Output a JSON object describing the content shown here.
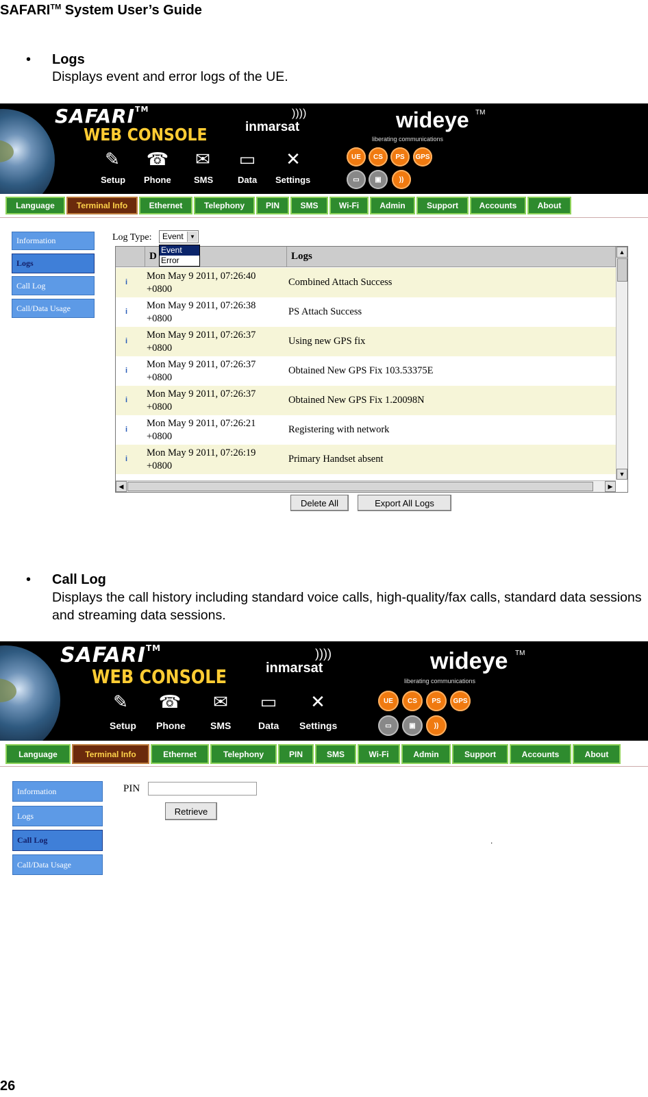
{
  "document": {
    "header_title": "SAFARI",
    "header_tm": "TM",
    "header_suffix": " System User’s Guide",
    "page_number": "26"
  },
  "sections": [
    {
      "bullet": "•",
      "title": "Logs",
      "description": "Displays event and error logs of the UE."
    },
    {
      "bullet": "•",
      "title": "Call Log",
      "description": "Displays the call history including standard voice calls, high-quality/fax calls, standard data sessions and streaming data sessions."
    }
  ],
  "console": {
    "logo": "SAFARI",
    "logo_tm": "TM",
    "subtitle": "WEB CONSOLE",
    "inmarsat": "inmarsat",
    "wideye": "wideye",
    "wideye_tm": "TM",
    "tagline": "liberating communications",
    "nav_icons": [
      {
        "label": "Setup",
        "icon": "wrench-setup-icon"
      },
      {
        "label": "Phone",
        "icon": "phone-icon"
      },
      {
        "label": "SMS",
        "icon": "envelope-icon"
      },
      {
        "label": "Data",
        "icon": "computer-icon"
      },
      {
        "label": "Settings",
        "icon": "tools-icon"
      }
    ],
    "status_icons_top": [
      "UE",
      "CS",
      "PS",
      "GPS"
    ],
    "status_icons_bottom": [
      "net",
      "lock",
      "wifi"
    ],
    "menu": [
      "Language",
      "Terminal Info",
      "Ethernet",
      "Telephony",
      "PIN",
      "SMS",
      "Wi-Fi",
      "Admin",
      "Support",
      "Accounts",
      "About"
    ],
    "active_menu": "Terminal Info",
    "sidebar": [
      "Information",
      "Logs",
      "Call Log",
      "Call/Data Usage"
    ]
  },
  "logs_screen": {
    "active_side": "Logs",
    "log_type_label": "Log Type:",
    "log_type_value": "Event",
    "log_type_options": [
      "Event",
      "Error"
    ],
    "columns": [
      "D",
      "Logs"
    ],
    "rows": [
      {
        "date": "Mon May 9 2011, 07:26:40",
        "tz": "+0800",
        "log": "Combined Attach Success"
      },
      {
        "date": "Mon May 9 2011, 07:26:38",
        "tz": "+0800",
        "log": "PS Attach Success"
      },
      {
        "date": "Mon May 9 2011, 07:26:37",
        "tz": "+0800",
        "log": "Using new GPS fix"
      },
      {
        "date": "Mon May 9 2011, 07:26:37",
        "tz": "+0800",
        "log": "Obtained New GPS Fix 103.53375E"
      },
      {
        "date": "Mon May 9 2011, 07:26:37",
        "tz": "+0800",
        "log": "Obtained New GPS Fix 1.20098N"
      },
      {
        "date": "Mon May 9 2011, 07:26:21",
        "tz": "+0800",
        "log": "Registering with network"
      },
      {
        "date": "Mon May 9 2011, 07:26:19",
        "tz": "+0800",
        "log": "Primary Handset absent"
      }
    ],
    "delete_all": "Delete All",
    "export_all": "Export All Logs"
  },
  "calllog_screen": {
    "active_side": "Call Log",
    "pin_label": "PIN",
    "pin_value": "",
    "retrieve": "Retrieve",
    "dot": "."
  }
}
